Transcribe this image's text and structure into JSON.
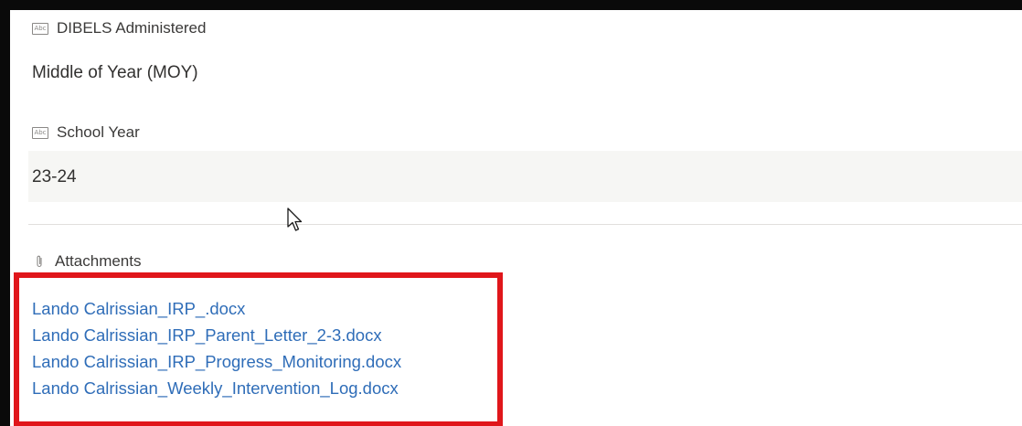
{
  "fields": [
    {
      "label": "DIBELS Administered",
      "value": "Middle of Year (MOY)",
      "icon": "text-field-icon"
    },
    {
      "label": "School Year",
      "value": "23-24",
      "icon": "text-field-icon"
    }
  ],
  "attachments": {
    "label": "Attachments",
    "icon": "paperclip-icon",
    "files": [
      "Lando Calrissian_IRP_.docx",
      "Lando Calrissian_IRP_Parent_Letter_2-3.docx",
      "Lando Calrissian_IRP_Progress_Monitoring.docx",
      "Lando Calrissian_Weekly_Intervention_Log.docx"
    ]
  },
  "abc_icon_text": "Abc",
  "colors": {
    "link": "#2f6db8",
    "highlight": "#e0161b",
    "frame": "#0a0a0a"
  }
}
